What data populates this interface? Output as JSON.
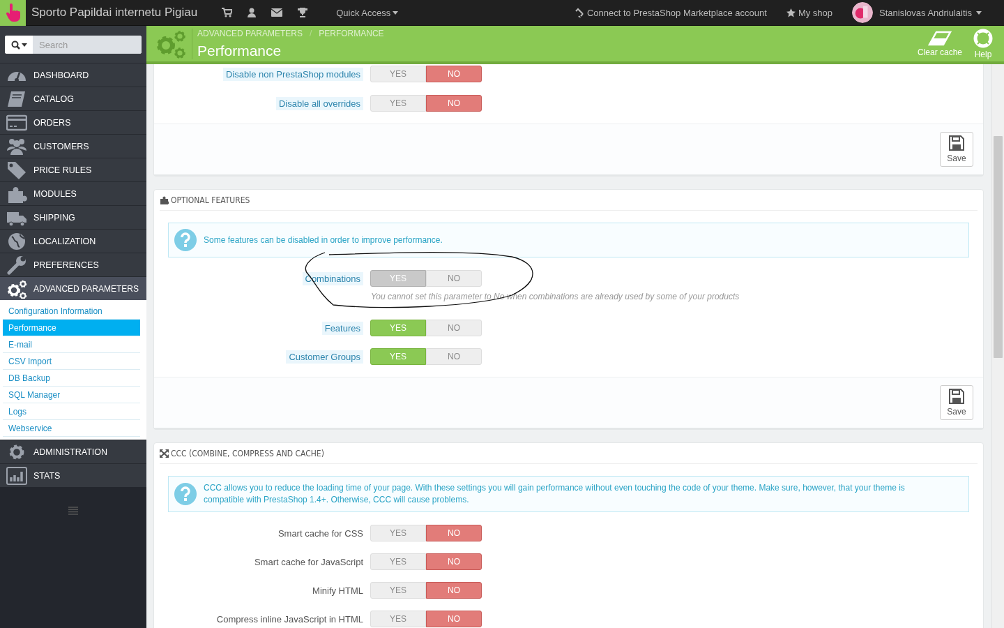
{
  "topbar": {
    "shop_name": "Sporto Papildai internetu Pigiau",
    "quick_access": "Quick Access",
    "marketplace": "Connect to PrestaShop Marketplace account",
    "my_shop": "My shop",
    "user": "Stanislovas Andriulaitis"
  },
  "sidebar": {
    "search_placeholder": "Search",
    "items": [
      {
        "label": "DASHBOARD",
        "selected": false
      },
      {
        "label": "CATALOG",
        "selected": false
      },
      {
        "label": "ORDERS",
        "selected": false
      },
      {
        "label": "CUSTOMERS",
        "selected": false
      },
      {
        "label": "PRICE RULES",
        "selected": false
      },
      {
        "label": "MODULES",
        "selected": false
      },
      {
        "label": "SHIPPING",
        "selected": false
      },
      {
        "label": "LOCALIZATION",
        "selected": false
      },
      {
        "label": "PREFERENCES",
        "selected": false
      },
      {
        "label": "ADVANCED PARAMETERS",
        "selected": true,
        "children": [
          {
            "label": "Configuration Information",
            "selected": false
          },
          {
            "label": "Performance",
            "selected": true
          },
          {
            "label": "E-mail",
            "selected": false
          },
          {
            "label": "CSV Import",
            "selected": false
          },
          {
            "label": "DB Backup",
            "selected": false
          },
          {
            "label": "SQL Manager",
            "selected": false
          },
          {
            "label": "Logs",
            "selected": false
          },
          {
            "label": "Webservice",
            "selected": false
          }
        ]
      },
      {
        "label": "ADMINISTRATION",
        "selected": false
      },
      {
        "label": "STATS",
        "selected": false
      }
    ]
  },
  "header": {
    "breadcrumb": [
      "ADVANCED PARAMETERS",
      "PERFORMANCE"
    ],
    "breadcrumb_separator": "/",
    "title": "Performance",
    "actions": [
      "Clear cache",
      "Help"
    ]
  },
  "panels": [
    {
      "rows": [
        {
          "label": "Disable non PrestaShop modules",
          "hint": true,
          "yes_label": "YES",
          "no_label": "NO",
          "value": false
        },
        {
          "label": "Disable all overrides",
          "hint": true,
          "yes_label": "YES",
          "no_label": "NO",
          "value": false
        }
      ],
      "save_label": "Save"
    },
    {
      "title": "OPTIONAL FEATURES",
      "alert": "Some features can be disabled in order to improve performance.",
      "annotated": true,
      "rows": [
        {
          "label": "Combinations",
          "hint": true,
          "yes_label": "YES",
          "no_label": "NO",
          "value": true,
          "disabled": true,
          "note": "You cannot set this parameter to No when combinations are already used by some of your products"
        },
        {
          "label": "Features",
          "hint": true,
          "yes_label": "YES",
          "no_label": "NO",
          "value": true
        },
        {
          "label": "Customer Groups",
          "hint": true,
          "yes_label": "YES",
          "no_label": "NO",
          "value": true
        }
      ],
      "save_label": "Save"
    },
    {
      "title": "CCC (COMBINE, COMPRESS AND CACHE)",
      "alert": "CCC allows you to reduce the loading time of your page. With these settings you will gain performance without even touching the code of your theme. Make sure, however, that your theme is compatible with PrestaShop 1.4+. Otherwise, CCC will cause problems.",
      "rows": [
        {
          "label": "Smart cache for CSS",
          "hint": false,
          "yes_label": "YES",
          "no_label": "NO",
          "value": false
        },
        {
          "label": "Smart cache for JavaScript",
          "hint": false,
          "yes_label": "YES",
          "no_label": "NO",
          "value": false
        },
        {
          "label": "Minify HTML",
          "hint": false,
          "yes_label": "YES",
          "no_label": "NO",
          "value": false
        },
        {
          "label": "Compress inline JavaScript in HTML",
          "hint": false,
          "yes_label": "YES",
          "no_label": "NO",
          "value": false
        }
      ]
    }
  ]
}
